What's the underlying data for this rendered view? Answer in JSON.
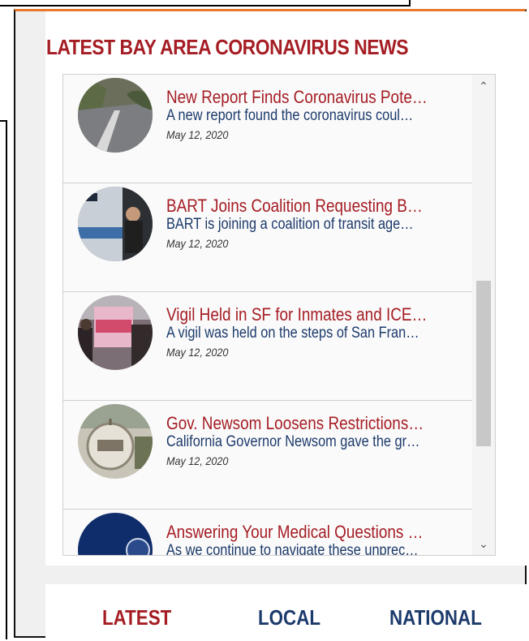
{
  "section": {
    "title": "LATEST BAY AREA CORONAVIRUS NEWS"
  },
  "news": {
    "items": [
      {
        "headline": "New Report Finds Coronavirus Pote…",
        "summary": "A new report found the coronavirus coul…",
        "date": "May 12, 2020",
        "thumb_icon": "road-photo"
      },
      {
        "headline": "BART Joins Coalition Requesting B…",
        "summary": "BART is joining a coalition of transit age…",
        "date": "May 12, 2020",
        "thumb_icon": "bart-photo"
      },
      {
        "headline": "Vigil Held in SF for Inmates and ICE…",
        "summary": "A vigil was held on the steps of San Fran…",
        "date": "May 12, 2020",
        "thumb_icon": "vigil-photo"
      },
      {
        "headline": "Gov. Newsom Loosens Restrictions…",
        "summary": "California Governor Newsom gave the gr…",
        "date": "May 12, 2020",
        "thumb_icon": "open-sign-photo"
      },
      {
        "headline": "Answering Your Medical Questions …",
        "summary": "As we continue to navigate these unprec…",
        "date": "",
        "thumb_icon": "medical-logo-photo"
      }
    ]
  },
  "tabs": {
    "latest": "LATEST",
    "local": "LOCAL",
    "national": "NATIONAL"
  },
  "colors": {
    "accent": "#a51d24",
    "link": "#1c3a6b",
    "border_top": "#e8782a"
  }
}
